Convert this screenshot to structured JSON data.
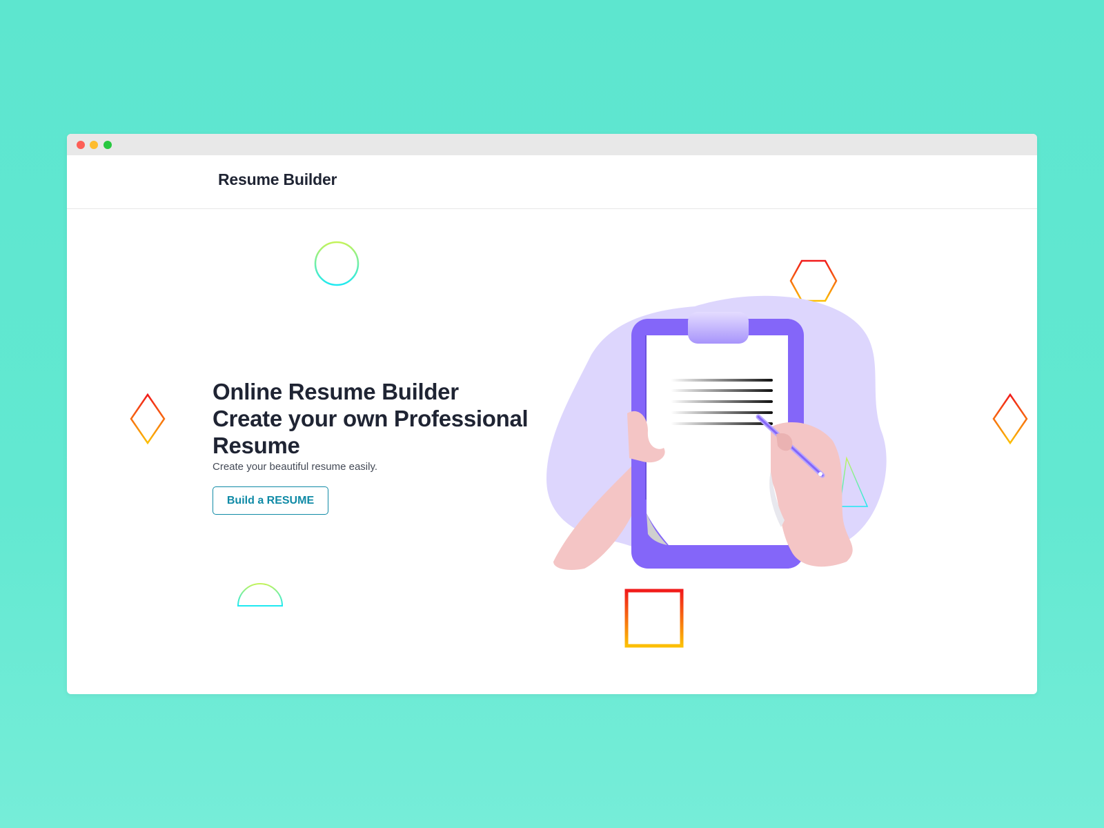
{
  "window": {
    "controls": [
      "close",
      "minimize",
      "maximize"
    ]
  },
  "navbar": {
    "brand": "Resume Builder"
  },
  "hero": {
    "title_lines": [
      "Online Resume Builder",
      "Create your own Professional",
      "Resume"
    ],
    "subtitle": "Create your beautiful resume easily.",
    "cta_label": "Build a RESUME"
  },
  "illustration": {
    "icon": "clipboard-with-hand-writing-illustration"
  },
  "colors": {
    "background": "#5de6cf",
    "accent": "#0f8aa6",
    "clipboard": "#8466f9",
    "blob": "#ddd6fd",
    "skin": "#f4c5c5",
    "heading": "#1f2433"
  }
}
